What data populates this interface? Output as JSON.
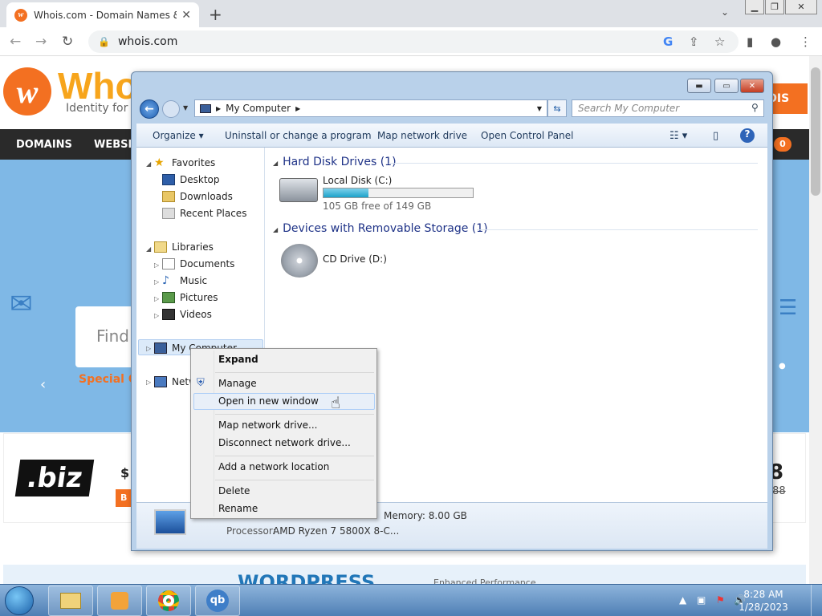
{
  "browser": {
    "tab_title": "Whois.com - Domain Names & I",
    "url": "whois.com"
  },
  "site": {
    "logo_text": "Who",
    "tagline": "Identity for e",
    "header_button": "OIS",
    "nav": [
      "DOMAINS",
      "WEBSIT"
    ],
    "cart_count": "0",
    "find_placeholder": "Find",
    "special_offer": "Special O",
    "promo_tld": ".biz",
    "promo_price_left": "$",
    "promo_price_right": "8",
    "promo_price_old": ".88",
    "promo_button": "B",
    "banner_text": "WORDPRESS",
    "banner_sub": "Enhanced Performance"
  },
  "explorer": {
    "address": "My Computer",
    "search_placeholder": "Search My Computer",
    "commands": {
      "organize": "Organize ▾",
      "uninstall": "Uninstall or change a program",
      "map_drive": "Map network drive",
      "control_panel": "Open Control Panel"
    },
    "nav": {
      "favorites": "Favorites",
      "desktop": "Desktop",
      "downloads": "Downloads",
      "recent": "Recent Places",
      "libraries": "Libraries",
      "documents": "Documents",
      "music": "Music",
      "pictures": "Pictures",
      "videos": "Videos",
      "computer": "My Computer",
      "network": "Netw"
    },
    "groups": {
      "hdd": "Hard Disk Drives (1)",
      "removable": "Devices with Removable Storage (1)"
    },
    "local_disk": {
      "name": "Local Disk (C:)",
      "free": "105 GB free of 149 GB",
      "used_fraction": 0.3
    },
    "cd_drive": "CD Drive (D:)",
    "details": {
      "memory": "Memory: 8.00 GB",
      "processor_label": "Processor:",
      "processor": "AMD Ryzen 7 5800X 8-C..."
    }
  },
  "context_menu": {
    "expand": "Expand",
    "manage": "Manage",
    "open_new": "Open in new window",
    "map_drive": "Map network drive...",
    "disconnect": "Disconnect network drive...",
    "add_location": "Add a network location",
    "delete": "Delete",
    "rename": "Rename"
  },
  "taskbar": {
    "time": "8:28 AM",
    "date": "1/28/2023",
    "qb": "qb"
  }
}
